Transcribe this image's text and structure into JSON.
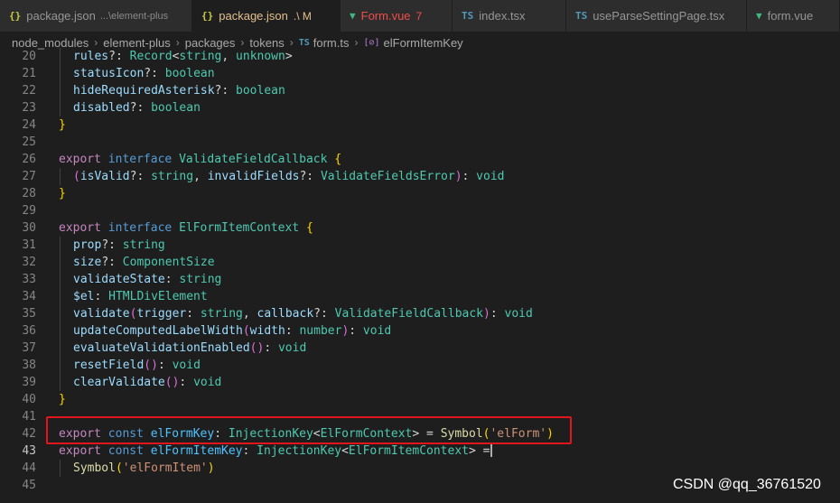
{
  "tabs": [
    {
      "icon": "{}",
      "icon_color": "#cbcb41",
      "name": "package.json",
      "desc": "...\\element-plus",
      "status": "",
      "status_color": ""
    },
    {
      "icon": "{}",
      "icon_color": "#cbcb41",
      "name": "package.json",
      "desc": "",
      "status": ".\\ M",
      "status_color": "#e2c08d"
    },
    {
      "icon": "▼",
      "icon_color": "#41b883",
      "name": "Form.vue",
      "desc": "",
      "status": "7",
      "status_color": "#f14c4c"
    },
    {
      "icon": "TS",
      "icon_color": "#519aba",
      "name": "index.tsx",
      "desc": "",
      "status": "",
      "status_color": ""
    },
    {
      "icon": "TS",
      "icon_color": "#519aba",
      "name": "useParseSettingPage.tsx",
      "desc": "",
      "status": "",
      "status_color": ""
    },
    {
      "icon": "▼",
      "icon_color": "#41b883",
      "name": "form.vue",
      "desc": "",
      "status": "",
      "status_color": ""
    }
  ],
  "breadcrumb": {
    "parts": [
      "node_modules",
      "element-plus",
      "packages",
      "tokens"
    ],
    "file_icon": "TS",
    "file": "form.ts",
    "symbol_icon": "[⊘]",
    "symbol": "elFormItemKey"
  },
  "code": {
    "line_numbers": [
      "20",
      "21",
      "22",
      "23",
      "24",
      "25",
      "26",
      "27",
      "28",
      "29",
      "30",
      "31",
      "32",
      "33",
      "34",
      "35",
      "36",
      "37",
      "38",
      "39",
      "40",
      "41",
      "42",
      "43",
      "44",
      "45"
    ],
    "current_line": "43",
    "text": {
      "l20": {
        "a": "rules",
        "b": "?: ",
        "c": "Record",
        "d": "<",
        "e": "string",
        "f": ", ",
        "g": "unknown",
        "h": ">"
      },
      "l21": {
        "a": "statusIcon",
        "b": "?: ",
        "c": "boolean"
      },
      "l22": {
        "a": "hideRequiredAsterisk",
        "b": "?: ",
        "c": "boolean"
      },
      "l23": {
        "a": "disabled",
        "b": "?: ",
        "c": "boolean"
      },
      "l24": {
        "a": "}"
      },
      "l26": {
        "a": "export",
        "b": "interface",
        "c": "ValidateFieldCallback",
        "d": "{"
      },
      "l27": {
        "a": "(",
        "b": "isValid",
        "c": "?: ",
        "d": "string",
        "e": ", ",
        "f": "invalidFields",
        "g": "?: ",
        "h": "ValidateFieldsError",
        "i": ")",
        "j": ": ",
        "k": "void"
      },
      "l28": {
        "a": "}"
      },
      "l30": {
        "a": "export",
        "b": "interface",
        "c": "ElFormItemContext",
        "d": "{"
      },
      "l31": {
        "a": "prop",
        "b": "?: ",
        "c": "string"
      },
      "l32": {
        "a": "size",
        "b": "?: ",
        "c": "ComponentSize"
      },
      "l33": {
        "a": "validateState",
        "b": ": ",
        "c": "string"
      },
      "l34": {
        "a": "$el",
        "b": ": ",
        "c": "HTMLDivElement"
      },
      "l35": {
        "a": "validate",
        "b": "(",
        "c": "trigger",
        "d": ": ",
        "e": "string",
        "f": ", ",
        "g": "callback",
        "h": "?: ",
        "i": "ValidateFieldCallback",
        "j": ")",
        "k": ": ",
        "l": "void"
      },
      "l36": {
        "a": "updateComputedLabelWidth",
        "b": "(",
        "c": "width",
        "d": ": ",
        "e": "number",
        "f": ")",
        "g": ": ",
        "h": "void"
      },
      "l37": {
        "a": "evaluateValidationEnabled",
        "b": "()",
        "c": ": ",
        "d": "void"
      },
      "l38": {
        "a": "resetField",
        "b": "()",
        "c": ": ",
        "d": "void"
      },
      "l39": {
        "a": "clearValidate",
        "b": "()",
        "c": ": ",
        "d": "void"
      },
      "l40": {
        "a": "}"
      },
      "l42": {
        "a": "export",
        "b": "const",
        "c": "elFormKey",
        "d": ": ",
        "e": "InjectionKey",
        "f": "<",
        "g": "ElFormContext",
        "h": ">",
        "i": " = ",
        "j": "Symbol",
        "k": "(",
        "l": "'elForm'",
        "m": ")"
      },
      "l43": {
        "a": "export",
        "b": "const",
        "c": "elFormItemKey",
        "d": ": ",
        "e": "InjectionKey",
        "f": "<",
        "g": "ElFormItemContext",
        "h": ">",
        "i": " ="
      },
      "l44": {
        "a": "Symbol",
        "b": "(",
        "c": "'elFormItem'",
        "d": ")"
      }
    }
  },
  "watermark": "CSDN @qq_36761520",
  "colors": {
    "highlight_box": "#e0161c"
  }
}
